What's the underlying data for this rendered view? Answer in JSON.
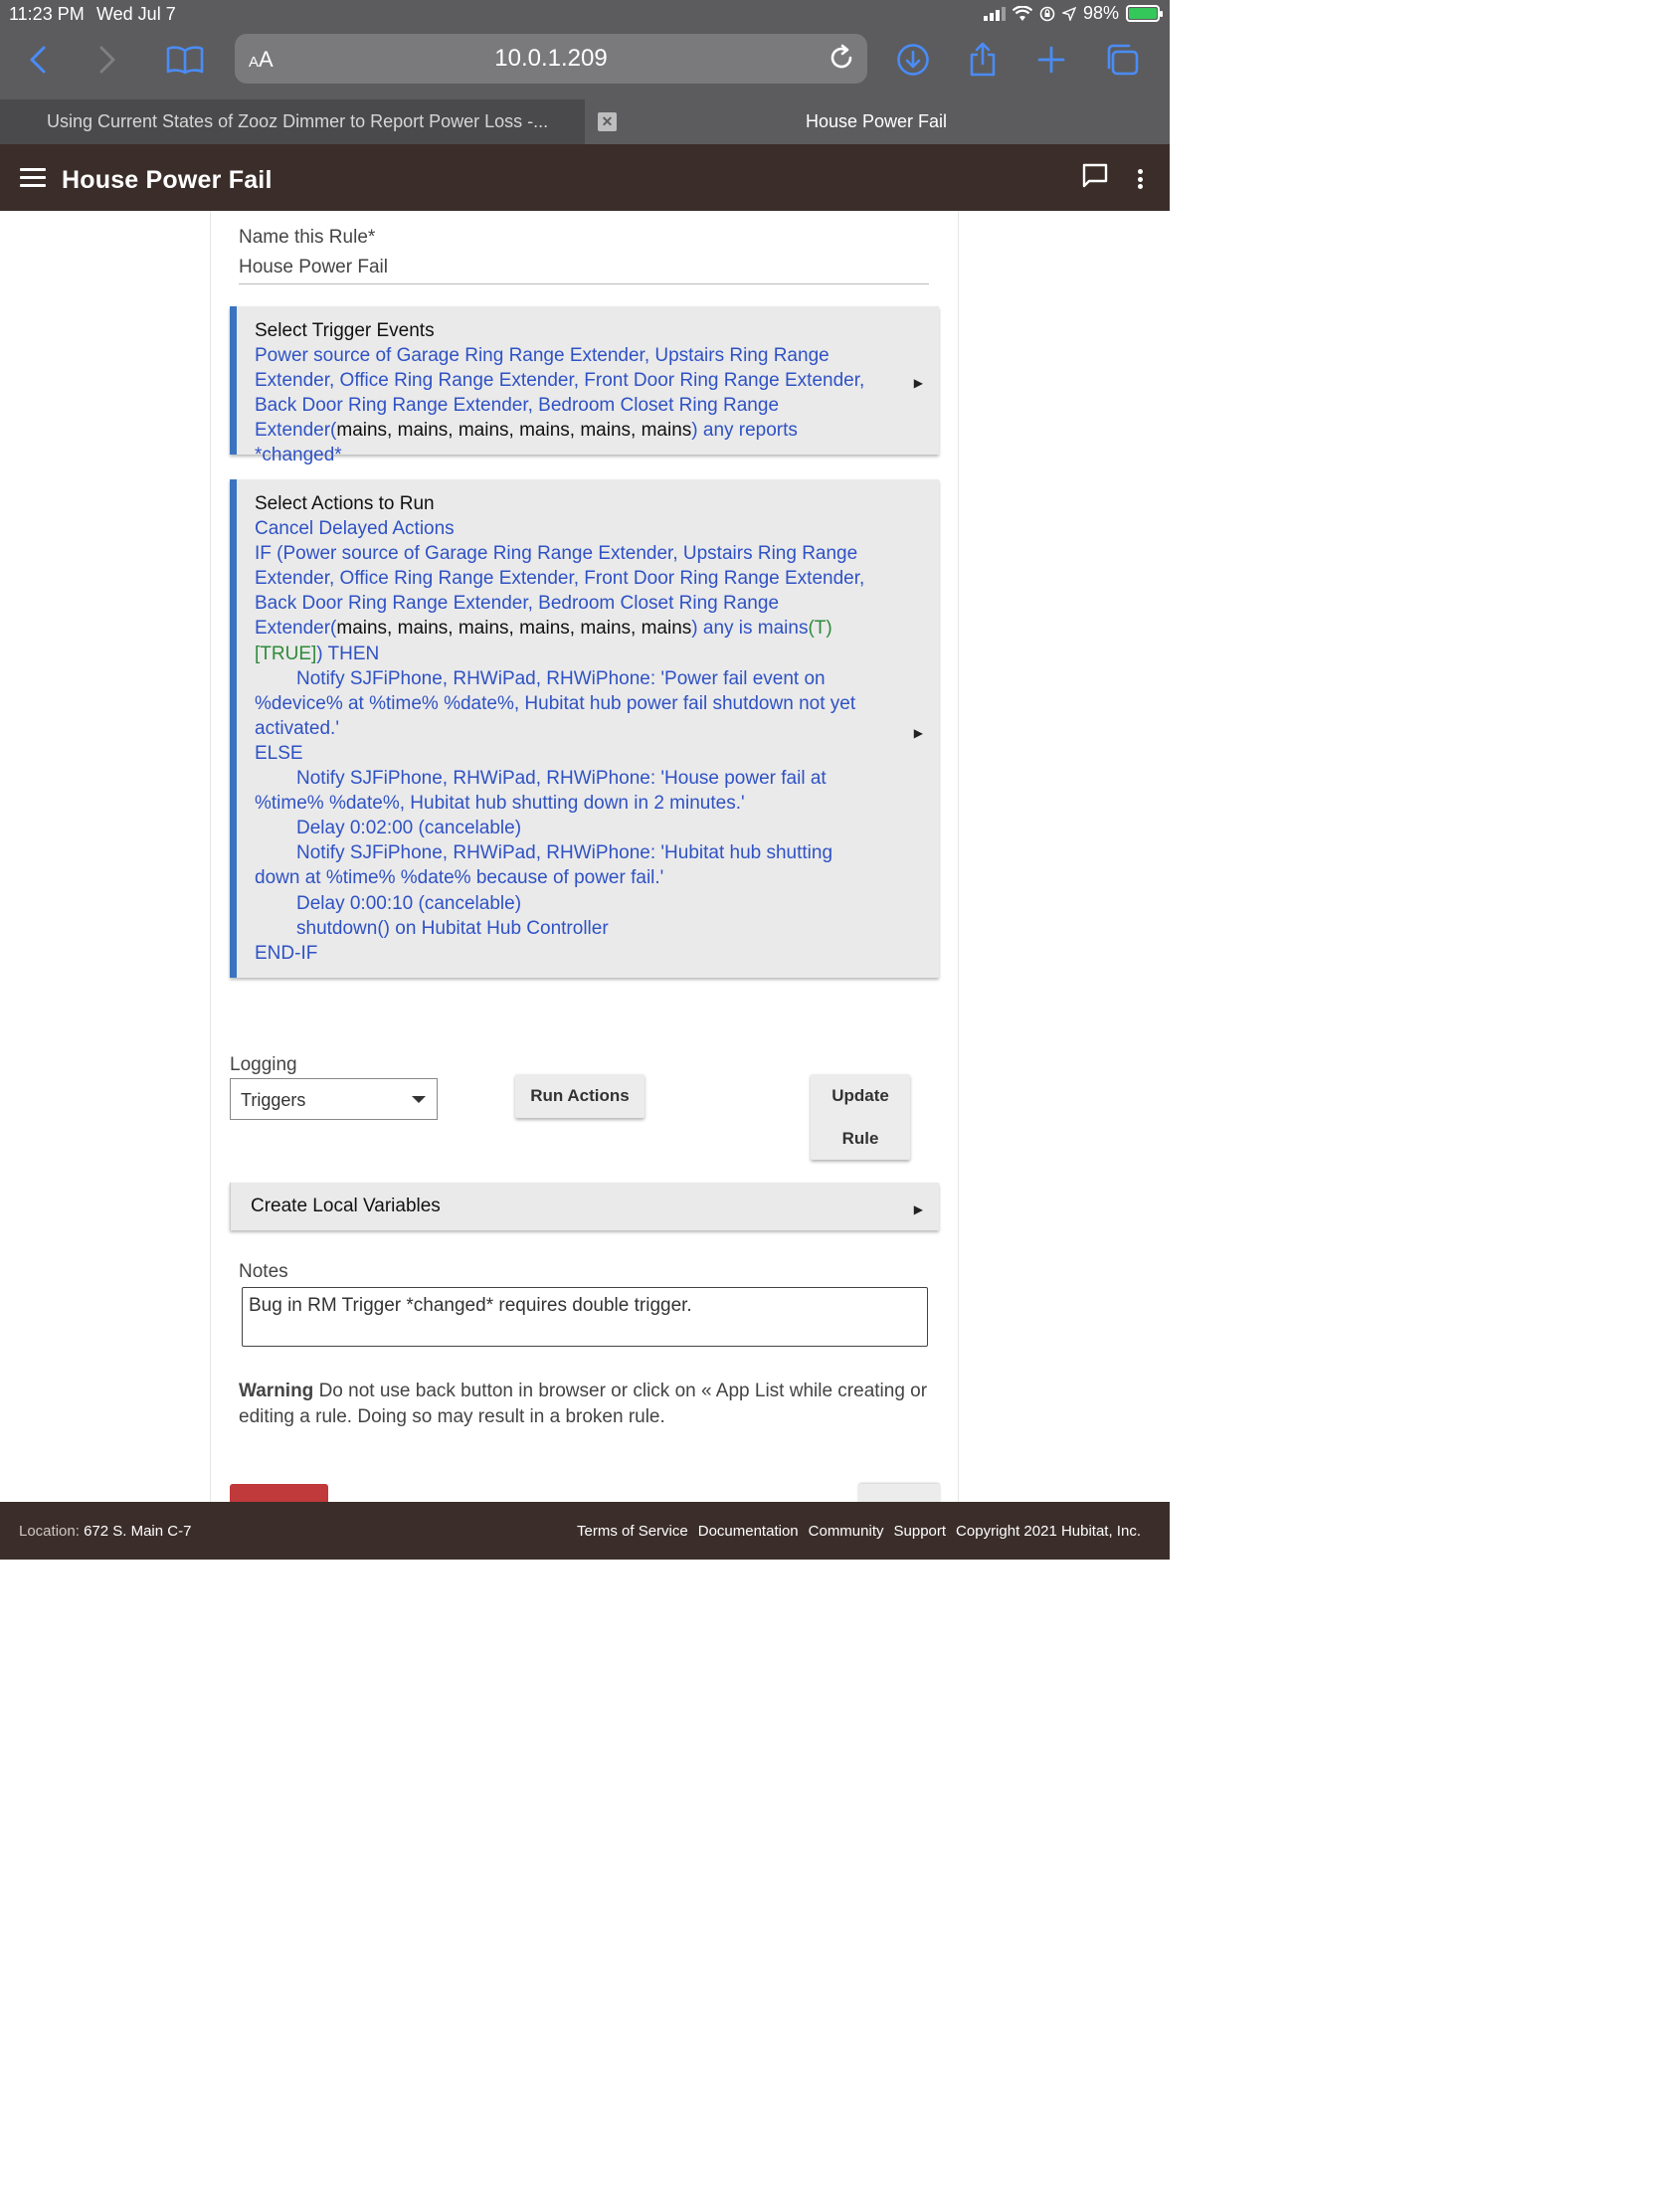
{
  "status_bar": {
    "time": "11:23 PM",
    "date": "Wed Jul 7",
    "battery": "98%"
  },
  "browser": {
    "text_size_label": "AA",
    "url": "10.0.1.209",
    "tabs": [
      {
        "title": "Using Current States of Zooz Dimmer to Report Power Loss -...",
        "active": false
      },
      {
        "title": "House Power Fail",
        "active": true
      }
    ],
    "tab_close_glyph": "✕"
  },
  "app_header": {
    "title": "House Power Fail"
  },
  "rule_name": {
    "label": "Name this Rule*",
    "value": "House Power Fail"
  },
  "triggers": {
    "title": "Select Trigger Events",
    "text_blue": "Power source of Garage Ring Range Extender, Upstairs Ring Range Extender, Office Ring Range Extender, Front Door Ring Range Extender, Back Door Ring Range Extender, Bedroom Closet Ring Range Extender(",
    "text_states": "mains, mains, mains, mains, mains, mains",
    "text_tail": ") any reports *changed*"
  },
  "actions": {
    "title": "Select Actions to Run",
    "line_cancel": "Cancel Delayed Actions",
    "if_text": "IF (Power source of Garage Ring Range Extender, Upstairs Ring Range Extender, Office Ring Range Extender, Front Door Ring Range Extender, Back Door Ring Range Extender, Bedroom Closet Ring Range Extender(",
    "if_states": "mains, mains, mains, mains, mains, mains",
    "if_cond": ") any is mains",
    "if_eval": "(T)",
    "if_true": "[TRUE]",
    "if_then": ") THEN",
    "notify1": "Notify SJFiPhone, RHWiPad, RHWiPhone: 'Power fail event on %device% at %time% %date%, Hubitat hub power fail shutdown not yet activated.'",
    "else": "ELSE",
    "notify2": "Notify SJFiPhone, RHWiPad, RHWiPhone: 'House power fail at %time% %date%, Hubitat hub shutting down in 2 minutes.'",
    "delay1": "Delay 0:02:00 (cancelable)",
    "notify3": "Notify SJFiPhone, RHWiPad, RHWiPhone: 'Hubitat hub shutting down at %time% %date% because of power fail.'",
    "delay2": "Delay 0:00:10 (cancelable)",
    "shutdown": "shutdown() on Hubitat Hub Controller",
    "endif": "END-IF"
  },
  "logging": {
    "label": "Logging",
    "selected": "Triggers"
  },
  "buttons": {
    "run_actions": "Run Actions",
    "update_rule_line1": "Update",
    "update_rule_line2": "Rule"
  },
  "local_variables": {
    "title": "Create Local Variables"
  },
  "notes": {
    "label": "Notes",
    "value": "Bug in RM Trigger *changed* requires double trigger."
  },
  "warning": {
    "bold": "Warning",
    "text": " Do not use back button in browser or click on « App List while creating or editing a rule. Doing so may result in a broken rule."
  },
  "footer": {
    "location_label": "Location:",
    "location_value": "672 S. Main C-7",
    "links": [
      "Terms of Service",
      "Documentation",
      "Community",
      "Support",
      "Copyright 2021 Hubitat, Inc."
    ]
  },
  "colors": {
    "header_bg": "#3b2e2a",
    "accent_blue": "#3a74c0",
    "link_blue": "#2f52c4",
    "true_green": "#2f8a3a",
    "remove_red": "#c0393b"
  }
}
